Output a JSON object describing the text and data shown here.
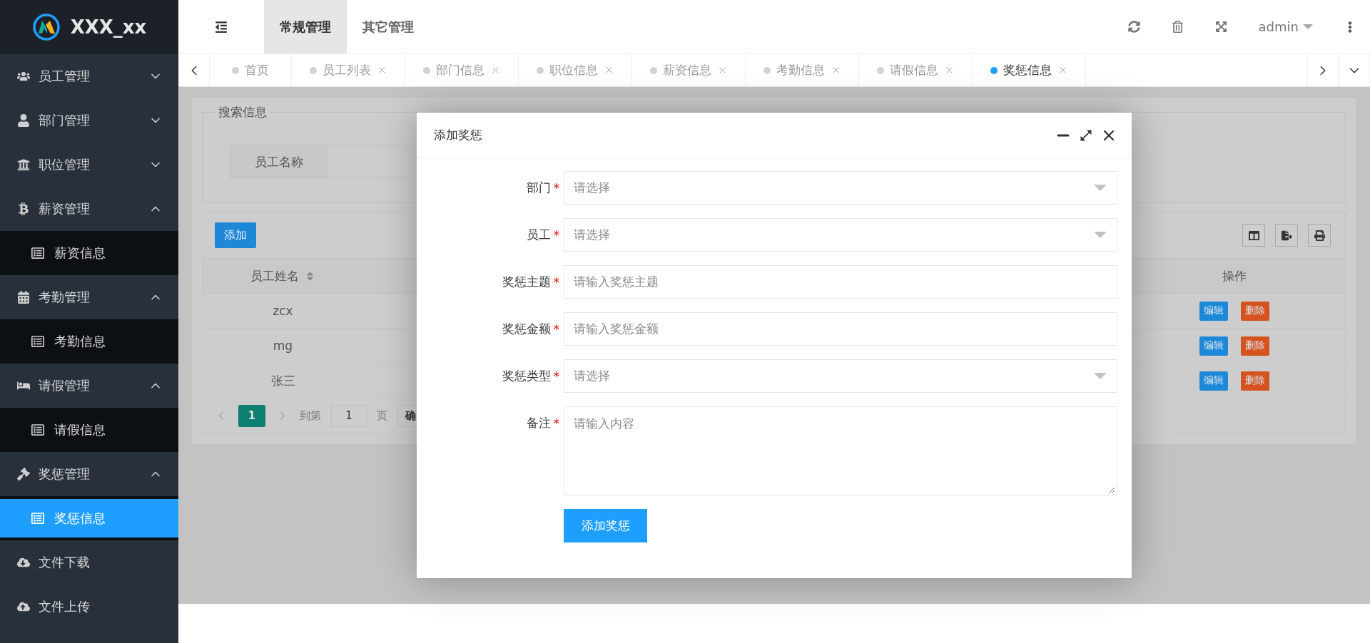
{
  "logo": {
    "text": "XXX_xx"
  },
  "header": {
    "nav": [
      {
        "label": "常规管理",
        "selected": true
      },
      {
        "label": "其它管理",
        "selected": false
      }
    ],
    "user": "admin"
  },
  "tabs": [
    {
      "label": "首页",
      "selected": false,
      "closable": false
    },
    {
      "label": "员工列表",
      "selected": false,
      "closable": true
    },
    {
      "label": "部门信息",
      "selected": false,
      "closable": true
    },
    {
      "label": "职位信息",
      "selected": false,
      "closable": true
    },
    {
      "label": "薪资信息",
      "selected": false,
      "closable": true
    },
    {
      "label": "考勤信息",
      "selected": false,
      "closable": true
    },
    {
      "label": "请假信息",
      "selected": false,
      "closable": true
    },
    {
      "label": "奖惩信息",
      "selected": true,
      "closable": true
    }
  ],
  "sidebar": {
    "items": [
      {
        "label": "员工管理",
        "kind": "group",
        "expanded": false
      },
      {
        "label": "部门管理",
        "kind": "group",
        "expanded": false
      },
      {
        "label": "职位管理",
        "kind": "group",
        "expanded": false
      },
      {
        "label": "薪资管理",
        "kind": "group",
        "expanded": true,
        "children": [
          {
            "label": "薪资信息",
            "selected": false
          }
        ]
      },
      {
        "label": "考勤管理",
        "kind": "group",
        "expanded": true,
        "children": [
          {
            "label": "考勤信息",
            "selected": false
          }
        ]
      },
      {
        "label": "请假管理",
        "kind": "group",
        "expanded": true,
        "children": [
          {
            "label": "请假信息",
            "selected": false
          }
        ]
      },
      {
        "label": "奖惩管理",
        "kind": "group",
        "expanded": true,
        "children": [
          {
            "label": "奖惩信息",
            "selected": true
          }
        ]
      },
      {
        "label": "文件下载",
        "kind": "link"
      },
      {
        "label": "文件上传",
        "kind": "link"
      }
    ]
  },
  "search": {
    "legend": "搜索信息",
    "label": "员工名称"
  },
  "table": {
    "add_button": "添加",
    "columns": [
      "员工姓名",
      "操作"
    ],
    "rows": [
      {
        "name": "zcx",
        "actions": [
          "编辑",
          "删除"
        ]
      },
      {
        "name": "mg",
        "actions": [
          "编辑",
          "删除"
        ]
      },
      {
        "name": "张三",
        "actions": [
          "编辑",
          "删除"
        ]
      }
    ],
    "pagination": {
      "current": "1",
      "goto_label": "到第",
      "page_value": "1",
      "page_unit": "页",
      "confirm": "确"
    }
  },
  "dialog": {
    "title": "添加奖惩",
    "fields": [
      {
        "label": "部门",
        "required_mark": "*",
        "kind": "select",
        "placeholder": "请选择"
      },
      {
        "label": "员工",
        "required_mark": "*",
        "kind": "select",
        "placeholder": "请选择"
      },
      {
        "label": "奖惩主题",
        "required_mark": "*",
        "kind": "input",
        "placeholder": "请输入奖惩主题"
      },
      {
        "label": "奖惩金额",
        "required_mark": "*",
        "kind": "input",
        "placeholder": "请输入奖惩金额"
      },
      {
        "label": "奖惩类型",
        "required_mark": "*",
        "kind": "select",
        "placeholder": "请选择"
      },
      {
        "label": "备注",
        "required_mark": "*",
        "kind": "textarea",
        "placeholder": "请输入内容"
      }
    ],
    "submit": "添加奖惩"
  }
}
